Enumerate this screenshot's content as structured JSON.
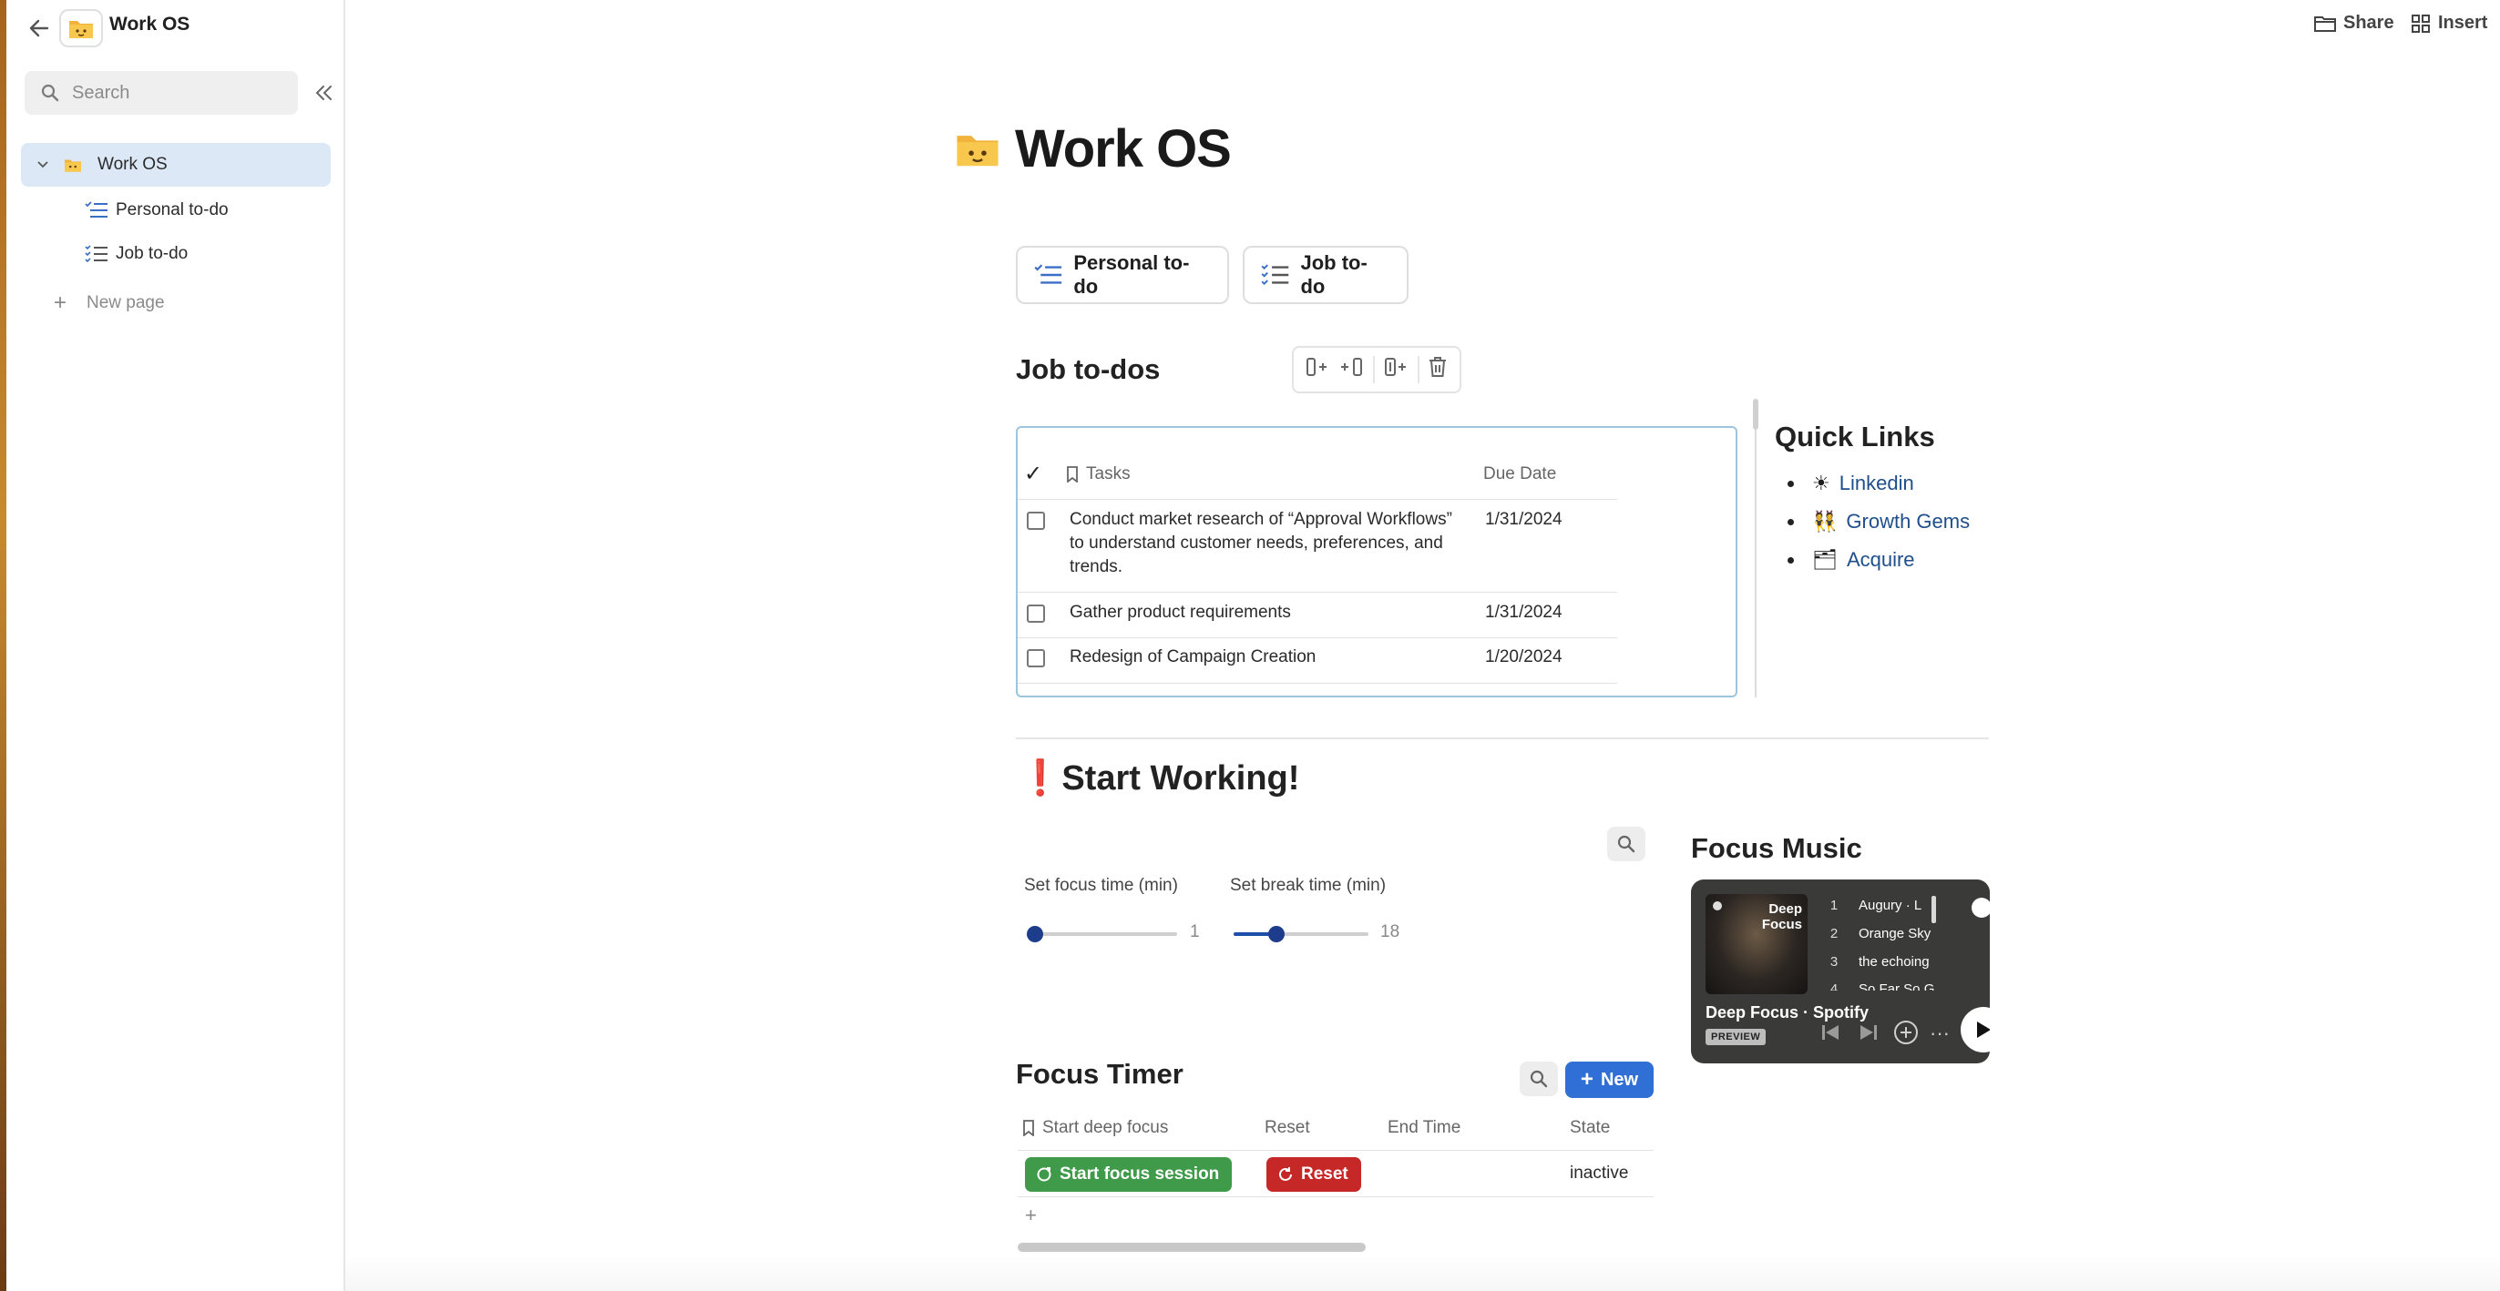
{
  "sidebar": {
    "doc_title": "Work OS",
    "search_placeholder": "Search",
    "items": [
      {
        "label": "Work OS"
      },
      {
        "label": "Personal to-do"
      },
      {
        "label": "Job to-do"
      }
    ],
    "new_page": "New page"
  },
  "topbar": {
    "share": "Share",
    "insert": "Insert"
  },
  "page": {
    "title": "Work OS"
  },
  "links": [
    {
      "label": "Personal to-do"
    },
    {
      "label": "Job to-do"
    }
  ],
  "job_todos": {
    "heading": "Job to-dos",
    "columns": {
      "check": "✓",
      "tasks": "Tasks",
      "due": "Due Date"
    },
    "rows": [
      {
        "task": "Conduct market research of “Approval Workflows” to understand customer needs, preferences, and trends.",
        "due": "1/31/2024"
      },
      {
        "task": "Gather product requirements",
        "due": "1/31/2024"
      },
      {
        "task": "Redesign of Campaign Creation",
        "due": "1/20/2024"
      }
    ]
  },
  "quick_links": {
    "heading": "Quick Links",
    "items": [
      {
        "emoji": "☀",
        "label": "Linkedin"
      },
      {
        "emoji": "👯",
        "label": "Growth Gems"
      },
      {
        "emoji": "🗂",
        "label": "Acquire"
      }
    ]
  },
  "start_working": {
    "emoji": "❗",
    "heading": "Start Working!"
  },
  "sliders": {
    "focus": {
      "label": "Set focus time (min)",
      "value": "1",
      "fraction": 0.05
    },
    "break": {
      "label": "Set break time (min)",
      "value": "18",
      "fraction": 0.32
    }
  },
  "focus_music": {
    "heading": "Focus Music",
    "cover_title": "Deep Focus",
    "tracks": [
      {
        "n": "1",
        "title": "Augury · L"
      },
      {
        "n": "2",
        "title": "Orange Sky"
      },
      {
        "n": "3",
        "title": "the echoing"
      },
      {
        "n": "4",
        "title": "So Far So G"
      }
    ],
    "footer": "Deep Focus · Spotify",
    "badge": "PREVIEW"
  },
  "focus_timer": {
    "heading": "Focus Timer",
    "new_label": "New",
    "columns": {
      "start": "Start deep focus",
      "reset": "Reset",
      "end": "End Time",
      "state": "State"
    },
    "row": {
      "start_btn": "Start focus session",
      "reset_btn": "Reset",
      "end": "",
      "state": "inactive"
    },
    "add": "+"
  },
  "colors": {
    "accent": "#2f6fd6",
    "link": "#1f4f8b",
    "green": "#3f9a4a",
    "red": "#c62828",
    "active_bg": "#dce8f6"
  },
  "icons": [
    "back-arrow-icon",
    "folder-emoji-icon",
    "search-icon",
    "collapse-icon",
    "chevron-down-icon",
    "checklist-icon",
    "plus-icon",
    "share-folder-icon",
    "insert-grid-icon",
    "trash-icon",
    "bookmark-icon",
    "play-icon"
  ]
}
